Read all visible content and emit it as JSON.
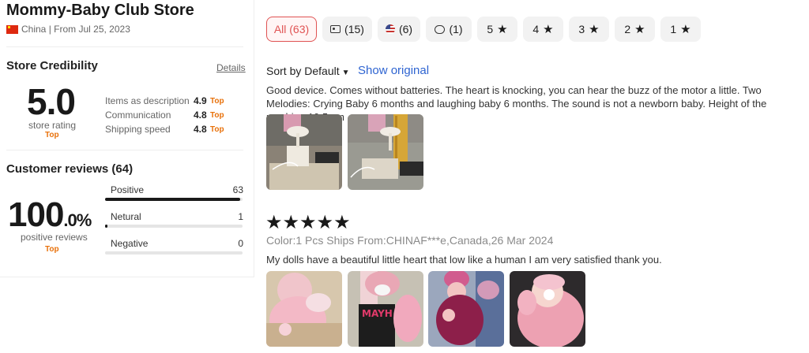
{
  "store": {
    "name": "Mommy-Baby Club Store",
    "country": "China",
    "since": "| From Jul 25, 2023"
  },
  "credibility": {
    "title": "Store Credibility",
    "details_label": "Details",
    "rating": "5.0",
    "rating_label": "store rating",
    "top_label": "Top",
    "metrics": [
      {
        "label": "Items as description",
        "value": "4.9",
        "tag": "Top"
      },
      {
        "label": "Communication",
        "value": "4.8",
        "tag": "Top"
      },
      {
        "label": "Shipping speed",
        "value": "4.8",
        "tag": "Top"
      }
    ]
  },
  "reviews_summary": {
    "title": "Customer reviews (64)",
    "percent_int": "100",
    "percent_dec": ".0%",
    "percent_label": "positive reviews",
    "top_label": "Top",
    "bars": [
      {
        "label": "Positive",
        "count": "63",
        "fraction": 0.984
      },
      {
        "label": "Netural",
        "count": "1",
        "fraction": 0.016
      },
      {
        "label": "Negative",
        "count": "0",
        "fraction": 0
      }
    ]
  },
  "filters": {
    "all": "All (63)",
    "photo": "(15)",
    "local": "(6)",
    "comments": "(1)",
    "stars": [
      "5",
      "4",
      "3",
      "2",
      "1"
    ]
  },
  "toolbar": {
    "sort_label": "Sort by Default",
    "show_original": "Show original"
  },
  "reviews": [
    {
      "text": "Good device. Comes without batteries. The heart is knocking, you can hear the buzz of the motor a little. Two Melodies: Crying Baby 6 months and laughing baby 6 months. The sound is not a newborn baby. Height of the machine 10,5 cm",
      "photos": 2
    },
    {
      "stars": "★★★★★",
      "rating": 5,
      "meta": "Color:1 Pcs Ships From:CHINAF***e,Canada,26 Mar 2024",
      "text": "My dolls have a beautiful little heart that low like a human I am very satisfied thank you.",
      "photos": 4
    }
  ],
  "colors": {
    "accent": "#e05353",
    "link": "#2e64d1",
    "top_tag": "#e8710a"
  }
}
